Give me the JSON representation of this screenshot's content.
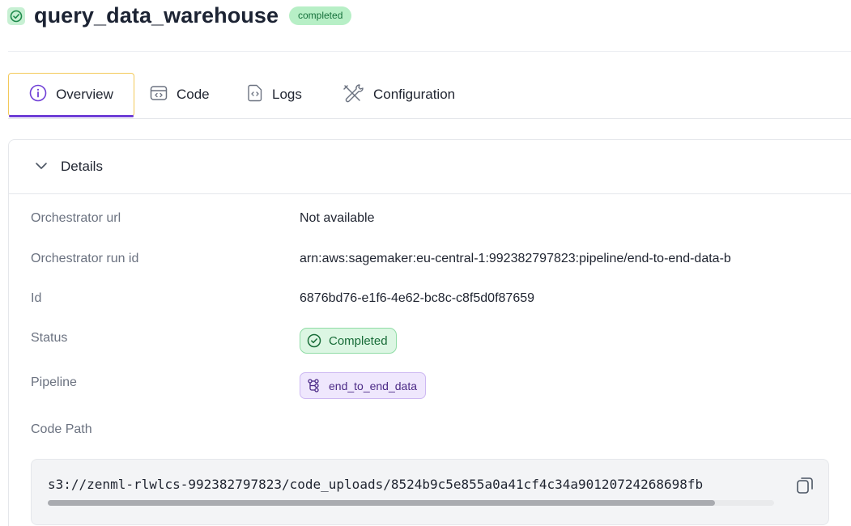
{
  "header": {
    "title": "query_data_warehouse",
    "badge": "completed",
    "status_icon": "check-circle-icon"
  },
  "tabs": [
    {
      "label": "Overview",
      "icon": "info-icon",
      "active": true
    },
    {
      "label": "Code",
      "icon": "code-window-icon"
    },
    {
      "label": "Logs",
      "icon": "file-code-icon"
    },
    {
      "label": "Configuration",
      "icon": "tools-icon"
    }
  ],
  "details": {
    "title": "Details",
    "rows": [
      {
        "label": "Orchestrator url",
        "value": "Not available"
      },
      {
        "label": "Orchestrator run id",
        "value": "arn:aws:sagemaker:eu-central-1:992382797823:pipeline/end-to-end-data-b"
      },
      {
        "label": "Id",
        "value": "6876bd76-e1f6-4e62-bc8c-c8f5d0f87659"
      },
      {
        "label": "Status",
        "value": "Completed"
      },
      {
        "label": "Pipeline",
        "value": "end_to_end_data"
      },
      {
        "label": "Code Path",
        "value": "s3://zenml-rlwlcs-992382797823/code_uploads/8524b9c5e855a0a41cf4c34a90120724268698fb"
      }
    ]
  },
  "colors": {
    "accent": "#6f3fd6",
    "success": "#15703a",
    "success_bg": "#dcf6e3",
    "pipeline_bg": "#efe7fd"
  }
}
